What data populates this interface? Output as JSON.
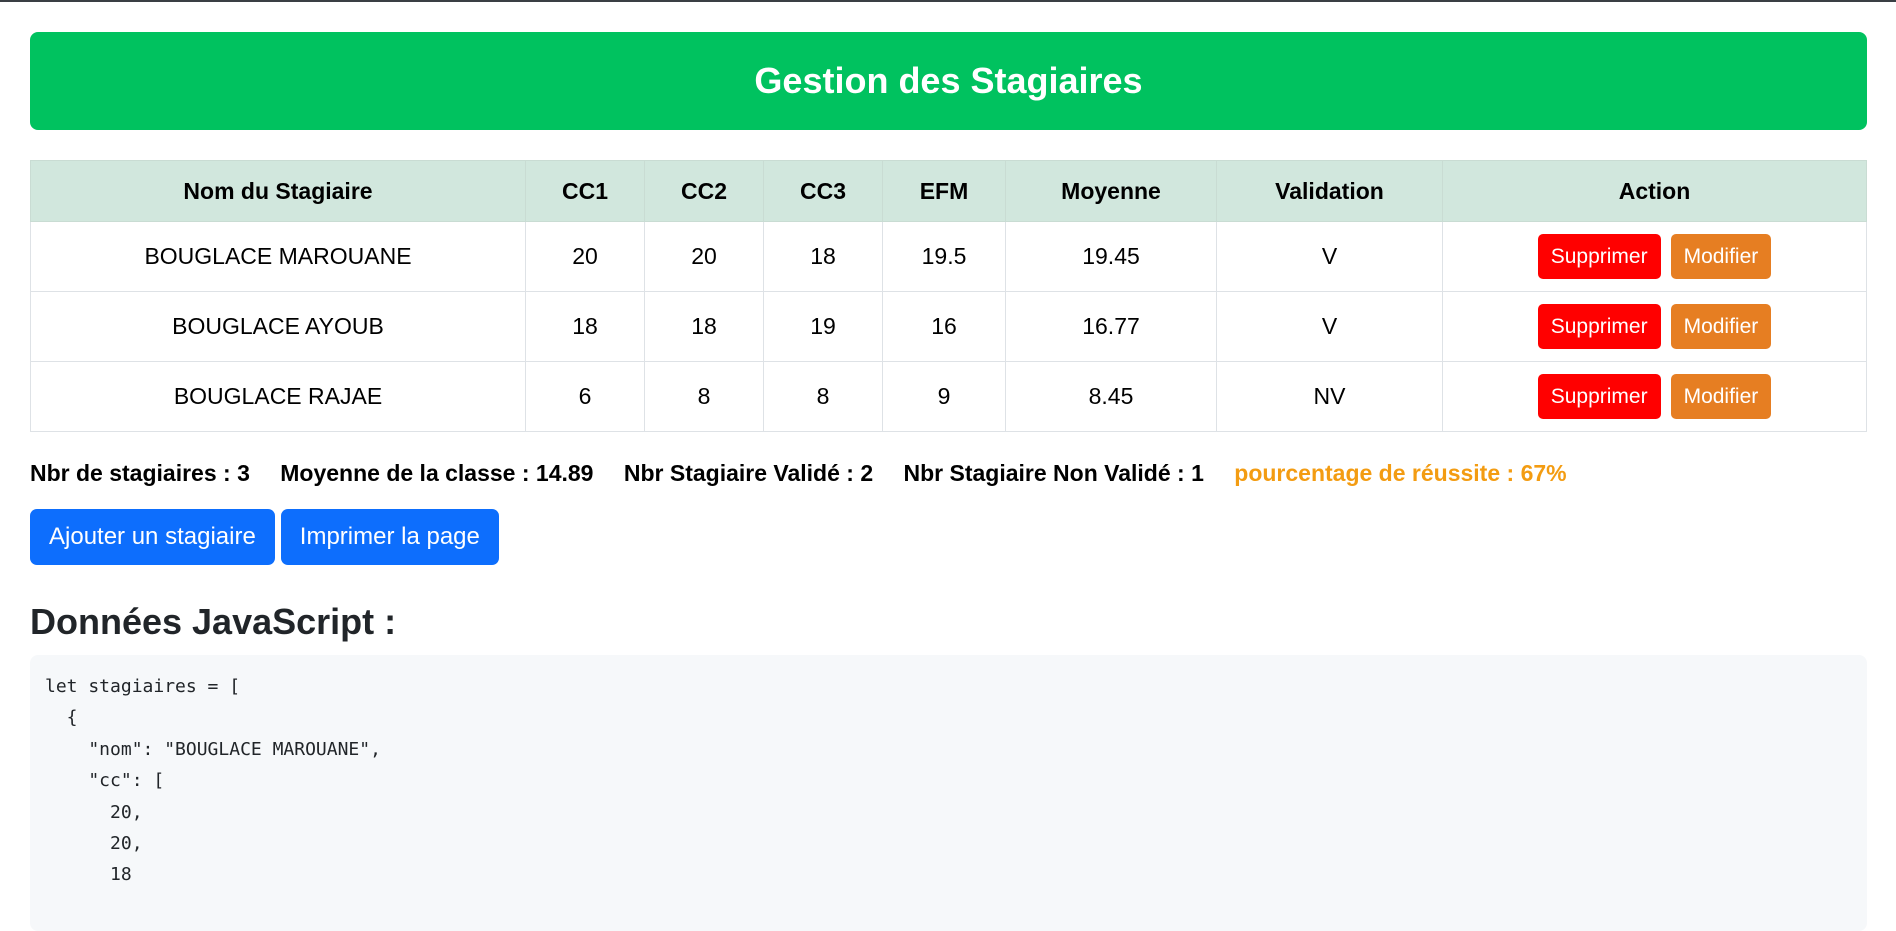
{
  "header": {
    "title": "Gestion des Stagiaires"
  },
  "table": {
    "columns": [
      "Nom du Stagiaire",
      "CC1",
      "CC2",
      "CC3",
      "EFM",
      "Moyenne",
      "Validation",
      "Action"
    ],
    "rows": [
      {
        "nom": "BOUGLACE MAROUANE",
        "cc1": "20",
        "cc2": "20",
        "cc3": "18",
        "efm": "19.5",
        "moyenne": "19.45",
        "validation": "V"
      },
      {
        "nom": "BOUGLACE AYOUB",
        "cc1": "18",
        "cc2": "18",
        "cc3": "19",
        "efm": "16",
        "moyenne": "16.77",
        "validation": "V"
      },
      {
        "nom": "BOUGLACE RAJAE",
        "cc1": "6",
        "cc2": "8",
        "cc3": "8",
        "efm": "9",
        "moyenne": "8.45",
        "validation": "NV"
      }
    ],
    "delete_label": "Supprimer",
    "edit_label": "Modifier"
  },
  "stats": {
    "count": "Nbr de stagiaires : 3",
    "average": "Moyenne de la classe : 14.89",
    "validated": "Nbr Stagiaire Validé : 2",
    "not_validated": "Nbr Stagiaire Non Validé : 1",
    "success_rate": "pourcentage de réussite : 67%"
  },
  "actions": {
    "add_label": "Ajouter un stagiaire",
    "print_label": "Imprimer la page"
  },
  "js_section": {
    "title": "Données JavaScript :",
    "code": "let stagiaires = [\n  {\n    \"nom\": \"BOUGLACE MAROUANE\",\n    \"cc\": [\n      20,\n      20,\n      18"
  },
  "colors": {
    "header_bg": "#00c25f",
    "table_header_bg": "#d1e7dd",
    "delete_button": "#ff0000",
    "edit_button": "#e67e22",
    "primary_button": "#0d6efd",
    "success_text": "#f39c12"
  }
}
